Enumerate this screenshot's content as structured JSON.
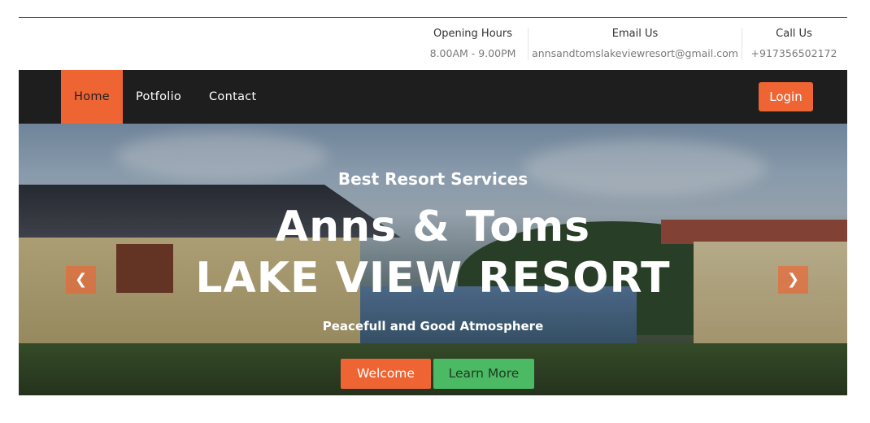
{
  "info": {
    "opening_title": "Opening Hours",
    "opening_value": "8.00AM - 9.00PM",
    "email_title": "Email Us",
    "email_value": "annsandtomslakeviewresort@gmail.com",
    "call_title": "Call Us",
    "call_value": "+917356502172"
  },
  "nav": {
    "home": "Home",
    "portfolio": "Potfolio",
    "contact": "Contact",
    "login": "Login"
  },
  "hero": {
    "subtitle": "Best Resort Services",
    "title_line1": "Anns & Toms",
    "title_line2": "LAKE VIEW RESORT",
    "tagline": "Peacefull and Good Atmosphere",
    "welcome_button": "Welcome",
    "learn_button": "Learn More",
    "prev_icon": "chevron-left-icon",
    "next_icon": "chevron-right-icon"
  },
  "colors": {
    "accent": "#ee6433",
    "green": "#4cb964",
    "nav_bg": "#1e1e1e"
  }
}
